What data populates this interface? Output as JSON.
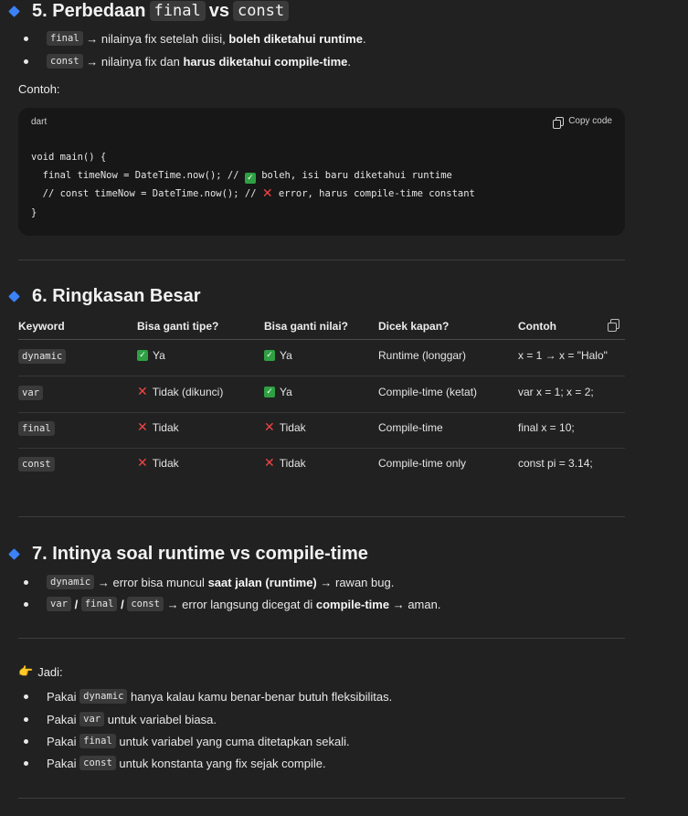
{
  "section5": {
    "title_prefix": "5. Perbedaan",
    "code_a": "final",
    "vs": "vs",
    "code_b": "const",
    "bullets": [
      {
        "code": "final",
        "text": "→ nilainya fix setelah diisi,",
        "bold": "boleh diketahui runtime",
        "end": "."
      },
      {
        "code": "const",
        "text": "→ nilainya fix dan",
        "bold": "harus diketahui compile-time",
        "end": "."
      }
    ],
    "example_label": "Contoh:",
    "codeblock": {
      "lang": "dart",
      "copy_label": "Copy code",
      "line1": "void main() {",
      "line2_pre": "  final timeNow = DateTime.now(); // ",
      "line2_post": " boleh, isi baru diketahui runtime",
      "line3_pre": "  // const timeNow = DateTime.now(); // ",
      "line3_post": " error, harus compile-time constant",
      "line4": "}"
    }
  },
  "section6": {
    "title": "6. Ringkasan Besar",
    "headers": [
      "Keyword",
      "Bisa ganti tipe?",
      "Bisa ganti nilai?",
      "Dicek kapan?",
      "Contoh"
    ],
    "rows": [
      {
        "kw": "dynamic",
        "tipe_ok": true,
        "tipe": "Ya",
        "nilai_ok": true,
        "nilai": "Ya",
        "kapan": "Runtime (longgar)",
        "contoh": "x = 1 → x = \"Halo\""
      },
      {
        "kw": "var",
        "tipe_ok": false,
        "tipe": "Tidak (dikunci)",
        "nilai_ok": true,
        "nilai": "Ya",
        "kapan": "Compile-time (ketat)",
        "contoh": "var x = 1; x = 2;"
      },
      {
        "kw": "final",
        "tipe_ok": false,
        "tipe": "Tidak",
        "nilai_ok": false,
        "nilai": "Tidak",
        "kapan": "Compile-time",
        "contoh": "final x = 10;"
      },
      {
        "kw": "const",
        "tipe_ok": false,
        "tipe": "Tidak",
        "nilai_ok": false,
        "nilai": "Tidak",
        "kapan": "Compile-time only",
        "contoh": "const pi = 3.14;"
      }
    ]
  },
  "section7": {
    "title": "7. Intinya soal runtime vs compile-time",
    "b1": {
      "code": "dynamic",
      "text": "→ error bisa muncul",
      "bold": "saat jalan (runtime)",
      "end": "→ rawan bug."
    },
    "b2": {
      "c1": "var",
      "sep": "/",
      "c2": "final",
      "c3": "const",
      "text": "→ error langsung dicegat di",
      "bold": "compile-time",
      "end": "→ aman."
    }
  },
  "summary": {
    "icon": "👉",
    "label": "Jadi:",
    "items": [
      {
        "pre": "Pakai",
        "code": "dynamic",
        "post": "hanya kalau kamu benar-benar butuh fleksibilitas."
      },
      {
        "pre": "Pakai",
        "code": "var",
        "post": "untuk variabel biasa."
      },
      {
        "pre": "Pakai",
        "code": "final",
        "post": "untuk variabel yang cuma ditetapkan sekali."
      },
      {
        "pre": "Pakai",
        "code": "const",
        "post": "untuk konstanta yang fix sejak compile."
      }
    ]
  }
}
